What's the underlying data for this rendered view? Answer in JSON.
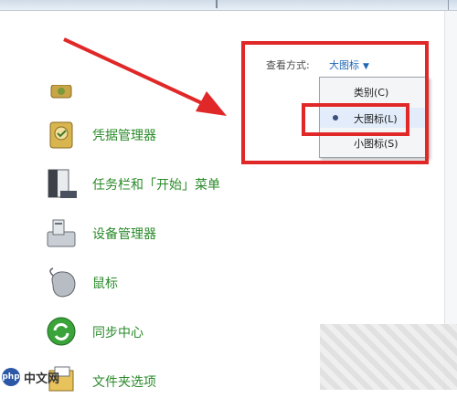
{
  "view_by": {
    "label": "查看方式:",
    "value": "大图标"
  },
  "view_menu": {
    "items": [
      {
        "label": "类别(C)",
        "selected": false
      },
      {
        "label": "大图标(L)",
        "selected": true
      },
      {
        "label": "小图标(S)",
        "selected": false
      }
    ]
  },
  "items": [
    {
      "label": "凭据管理器",
      "icon": "credential-manager-icon"
    },
    {
      "label": "任务栏和「开始」菜单",
      "icon": "taskbar-icon"
    },
    {
      "label": "设备管理器",
      "icon": "device-manager-icon"
    },
    {
      "label": "鼠标",
      "icon": "mouse-icon"
    },
    {
      "label": "同步中心",
      "icon": "sync-center-icon"
    },
    {
      "label": "文件夹选项",
      "icon": "folder-options-icon"
    }
  ],
  "watermark": {
    "logo": "php",
    "text": "中文网"
  },
  "colors": {
    "accent": "#e02828",
    "link": "#1e67b4",
    "item_text": "#2a8a2a"
  }
}
